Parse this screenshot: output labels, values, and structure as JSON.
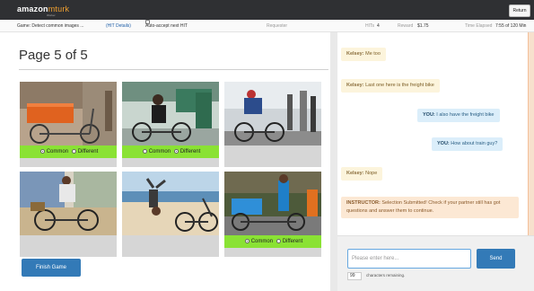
{
  "topbar": {
    "logo_main": "amazon",
    "logo_accent": "mturk",
    "logo_sub": "Worker",
    "return_label": "Return"
  },
  "infobar": {
    "game_title": "Game: Detect common images ...",
    "hit_details_link": "(HIT Details)",
    "auto_accept_label": "Auto-accept next HIT",
    "requester_label": "Requester",
    "hits_label": "HITs",
    "hits_value": "4",
    "reward_label": "Reward",
    "reward_value": "$1.75",
    "time_label": "Time Elapsed",
    "time_value": "7:55 of 120 Min"
  },
  "game": {
    "page_title": "Page 5 of 5",
    "finish_label": "Finish Game",
    "common_label": "Common",
    "different_label": "Different",
    "tiles": [
      {
        "subject": "orange cargo bike by a wall",
        "selection": "common",
        "has_radios": true
      },
      {
        "subject": "man lifting a bike on a train",
        "selection": "different",
        "has_radios": true
      },
      {
        "subject": "cyclist in a race",
        "selection": null,
        "has_radios": false
      },
      {
        "subject": "person riding a bicycle",
        "selection": null,
        "has_radios": false
      },
      {
        "subject": "handstand on a beach with bikes",
        "selection": null,
        "has_radios": false
      },
      {
        "subject": "delivery worker with freight bike",
        "selection": "common",
        "has_radios": true
      }
    ]
  },
  "chat": {
    "messages": [
      {
        "role": "partner",
        "speaker": "Kelsey:",
        "text": "Me too"
      },
      {
        "role": "partner",
        "speaker": "Kelsey:",
        "text": "Last one here is the freight bike"
      },
      {
        "role": "you",
        "speaker": "YOU:",
        "text": "I also have the freight bike"
      },
      {
        "role": "you",
        "speaker": "YOU:",
        "text": "How about train guy?"
      },
      {
        "role": "partner",
        "speaker": "Kelsey:",
        "text": "Nope"
      },
      {
        "role": "instructor",
        "speaker": "INSTRUCTOR:",
        "text": "Selection Submitted! Check if your partner still has got questions and answer them to continue."
      }
    ],
    "input_placeholder": "Please enter here...",
    "send_label": "Send",
    "remaining_count": "99",
    "remaining_text": "characters remaining."
  },
  "colors": {
    "topbar": "#2f3033",
    "accent_blue": "#337ab7",
    "radio_green": "#8ae234",
    "partner_bubble": "#fcf4dc",
    "you_bubble": "#dbeefa",
    "instructor_bubble": "#fce8d4"
  }
}
